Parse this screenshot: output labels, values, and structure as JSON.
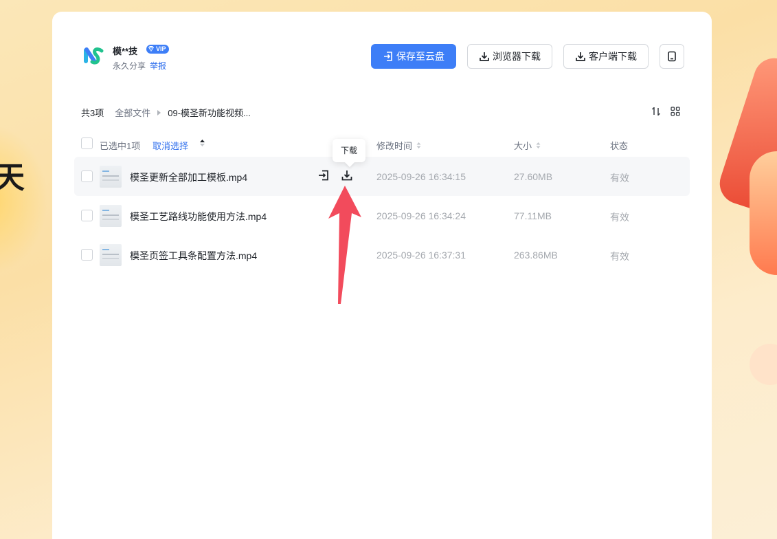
{
  "owner": {
    "name": "模**技",
    "vip_label": "VIP",
    "share_type": "永久分享",
    "report_label": "举报"
  },
  "actions": {
    "save_to_cloud": "保存至云盘",
    "browser_download": "浏览器下载",
    "client_download": "客户端下载"
  },
  "breadcrumb": {
    "count": "共3项",
    "root": "全部文件",
    "current": "09-模圣新功能视频..."
  },
  "table": {
    "selected_label": "已选中1项",
    "cancel_label": "取消选择",
    "columns": {
      "modified": "修改时间",
      "size": "大小",
      "status": "状态"
    },
    "rows": [
      {
        "name": "模圣更新全部加工模板.mp4",
        "modified": "2025-09-26 16:34:15",
        "size": "27.60MB",
        "status": "有效"
      },
      {
        "name": "模圣工艺路线功能使用方法.mp4",
        "modified": "2025-09-26 16:34:24",
        "size": "77.11MB",
        "status": "有效"
      },
      {
        "name": "模圣页签工具条配置方法.mp4",
        "modified": "2025-09-26 16:37:31",
        "size": "263.86MB",
        "status": "有效"
      }
    ]
  },
  "tooltip": "下载",
  "colors": {
    "primary": "#3d7ef7",
    "annotation_arrow": "#f24b5c"
  },
  "icons": [
    "save-to-cloud-icon",
    "download-icon",
    "phone-icon",
    "sort-icon",
    "grid-view-icon",
    "diamond-icon"
  ]
}
